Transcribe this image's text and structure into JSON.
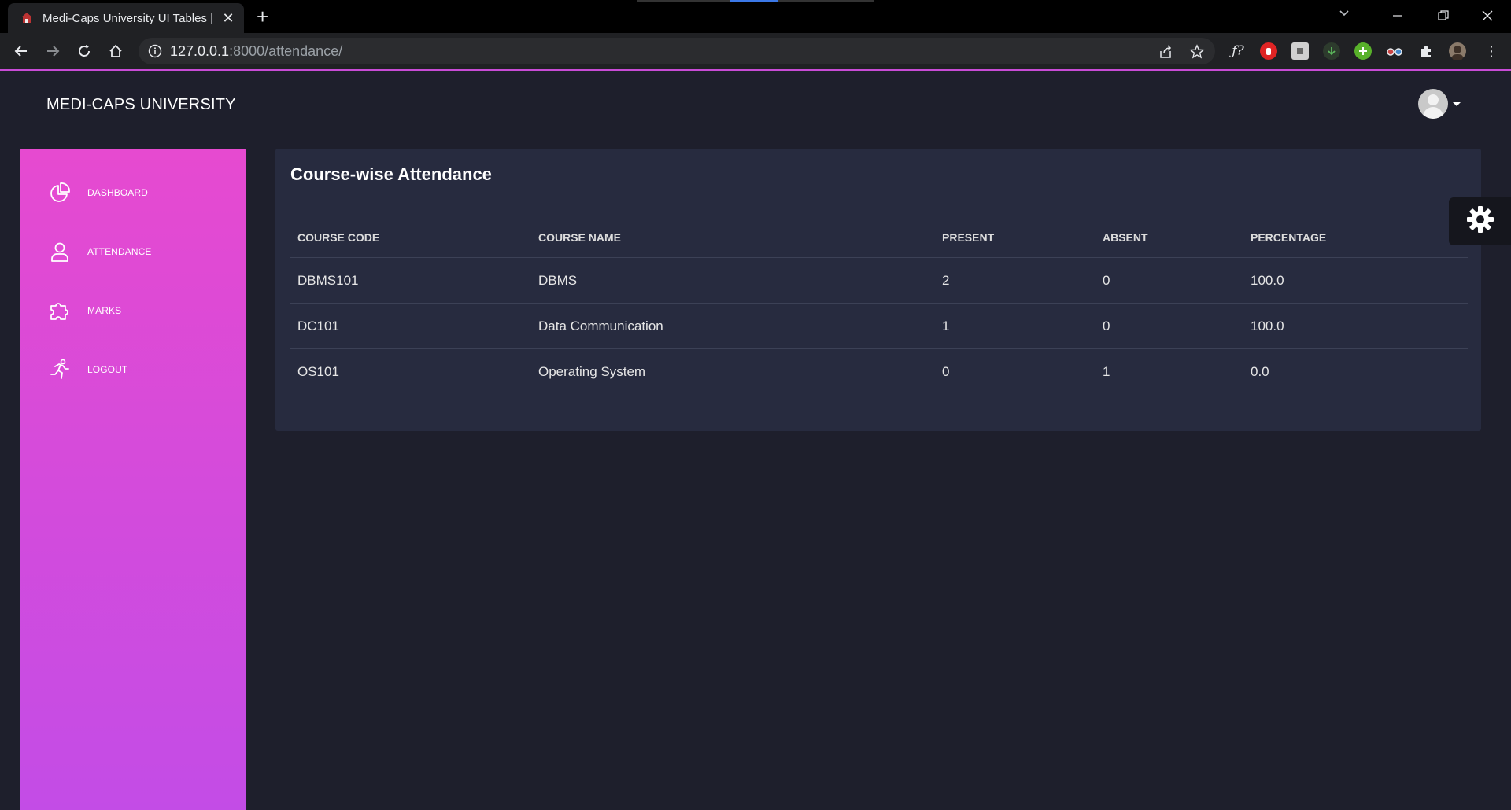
{
  "browser": {
    "tab_title": "Medi-Caps University UI Tables |",
    "url_host": "127.0.0.1",
    "url_path": ":8000/attendance/"
  },
  "page": {
    "brand": "MEDI-CAPS UNIVERSITY",
    "title": "Course-wise Attendance"
  },
  "sidebar": {
    "items": [
      {
        "label": "DASHBOARD",
        "icon": "pie-chart-icon"
      },
      {
        "label": "ATTENDANCE",
        "icon": "user-icon"
      },
      {
        "label": "MARKS",
        "icon": "puzzle-icon"
      },
      {
        "label": "LOGOUT",
        "icon": "running-person-icon"
      }
    ]
  },
  "table": {
    "headers": [
      "COURSE CODE",
      "COURSE NAME",
      "PRESENT",
      "ABSENT",
      "PERCENTAGE"
    ],
    "rows": [
      [
        "DBMS101",
        "DBMS",
        "2",
        "0",
        "100.0"
      ],
      [
        "DC101",
        "Data Communication",
        "1",
        "0",
        "100.0"
      ],
      [
        "OS101",
        "Operating System",
        "0",
        "1",
        "0.0"
      ]
    ]
  },
  "colors": {
    "sidebar_top": "#e64ad0",
    "sidebar_bottom": "#c34ce6",
    "card_bg": "#272b3f",
    "page_bg": "#1e1f2c"
  }
}
